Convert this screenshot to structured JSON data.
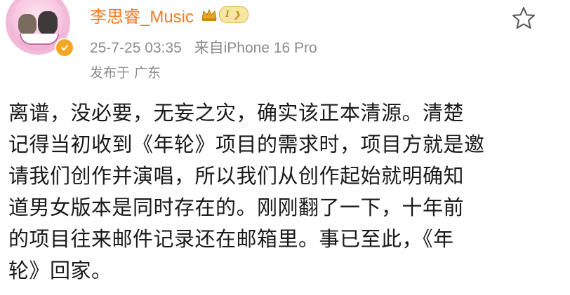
{
  "post": {
    "username": "李思睿_Music",
    "level_badge": "I",
    "timestamp": "25-7-25 03:35",
    "source": "来自iPhone 16 Pro",
    "location": "发布于 广东",
    "body_lines": [
      "离谱，没必要，无妄之灾，确实该正本清源。清楚",
      "记得当初收到《年轮》项目的需求时，项目方就是邀",
      "请我们创作并演唱，所以我们从创作起始就明确知",
      "道男女版本是同时存在的。刚刚翻了一下，十年前",
      "的项目往来邮件记录还在邮箱里。事已至此，《年",
      "轮》回家。"
    ]
  },
  "icons": {
    "verified": "verified-badge-icon",
    "crown": "crown-icon",
    "favorite": "star-outline-icon"
  },
  "colors": {
    "username": "#f07b24",
    "meta": "#8c8c8c",
    "badge_gold": "#f5a623"
  }
}
